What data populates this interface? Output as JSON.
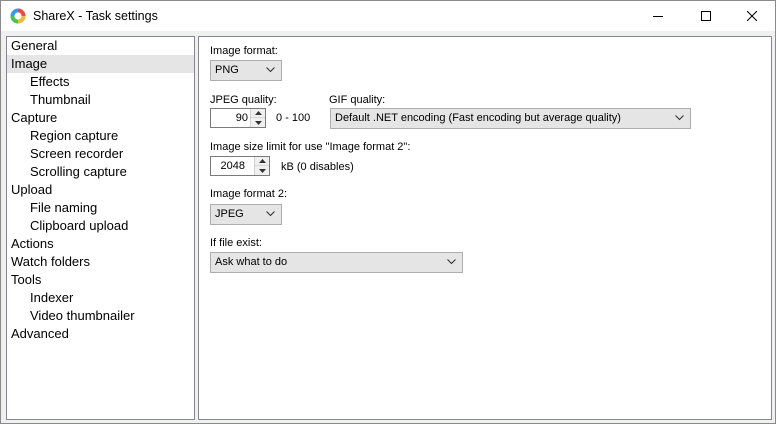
{
  "window": {
    "title": "ShareX - Task settings"
  },
  "sidebar": {
    "items": [
      {
        "label": "General",
        "level": 0,
        "selected": false
      },
      {
        "label": "Image",
        "level": 0,
        "selected": true
      },
      {
        "label": "Effects",
        "level": 1,
        "selected": false
      },
      {
        "label": "Thumbnail",
        "level": 1,
        "selected": false
      },
      {
        "label": "Capture",
        "level": 0,
        "selected": false
      },
      {
        "label": "Region capture",
        "level": 1,
        "selected": false
      },
      {
        "label": "Screen recorder",
        "level": 1,
        "selected": false
      },
      {
        "label": "Scrolling capture",
        "level": 1,
        "selected": false
      },
      {
        "label": "Upload",
        "level": 0,
        "selected": false
      },
      {
        "label": "File naming",
        "level": 1,
        "selected": false
      },
      {
        "label": "Clipboard upload",
        "level": 1,
        "selected": false
      },
      {
        "label": "Actions",
        "level": 0,
        "selected": false
      },
      {
        "label": "Watch folders",
        "level": 0,
        "selected": false
      },
      {
        "label": "Tools",
        "level": 0,
        "selected": false
      },
      {
        "label": "Indexer",
        "level": 1,
        "selected": false
      },
      {
        "label": "Video thumbnailer",
        "level": 1,
        "selected": false
      },
      {
        "label": "Advanced",
        "level": 0,
        "selected": false
      }
    ]
  },
  "image": {
    "format_label": "Image format:",
    "format_value": "PNG",
    "jpeg_quality_label": "JPEG quality:",
    "jpeg_quality_value": "90",
    "jpeg_quality_range": "0 - 100",
    "gif_quality_label": "GIF quality:",
    "gif_quality_value": "Default .NET encoding (Fast encoding but average quality)",
    "size_limit_label": "Image size limit for use \"Image format 2\":",
    "size_limit_value": "2048",
    "size_limit_unit": "kB (0 disables)",
    "format2_label": "Image format 2:",
    "format2_value": "JPEG",
    "file_exist_label": "If file exist:",
    "file_exist_value": "Ask what to do"
  },
  "colors": {
    "selection": "#e5e5e5",
    "border": "#828790",
    "titlebar": "#ffffff"
  }
}
